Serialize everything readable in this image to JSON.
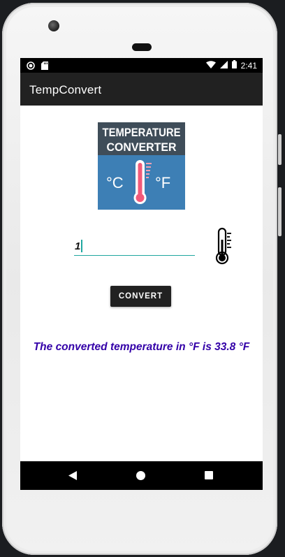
{
  "status_bar": {
    "time": "2:41"
  },
  "app_bar": {
    "title": "TempConvert"
  },
  "logo": {
    "line1": "TEMPERATURE",
    "line2": "CONVERTER",
    "left_unit": "°C",
    "right_unit": "°F"
  },
  "input": {
    "value": "1"
  },
  "convert_button": {
    "label": "CONVERT"
  },
  "result": {
    "text": "The converted temperature in °F is 33.8 °F"
  },
  "colors": {
    "app_bar": "#212121",
    "accent": "#20a7a0",
    "result_text": "#3300a8",
    "logo_top": "#3f4d59",
    "logo_bottom": "#3d7fb5",
    "thermometer_red": "#f25a7a"
  },
  "icons": {
    "status_left": [
      "record-icon",
      "sd-card-icon"
    ],
    "status_right": [
      "wifi-icon",
      "signal-icon",
      "battery-icon"
    ],
    "nav": [
      "back-icon",
      "home-icon",
      "recents-icon"
    ],
    "thermometer": "thermometer-icon"
  }
}
